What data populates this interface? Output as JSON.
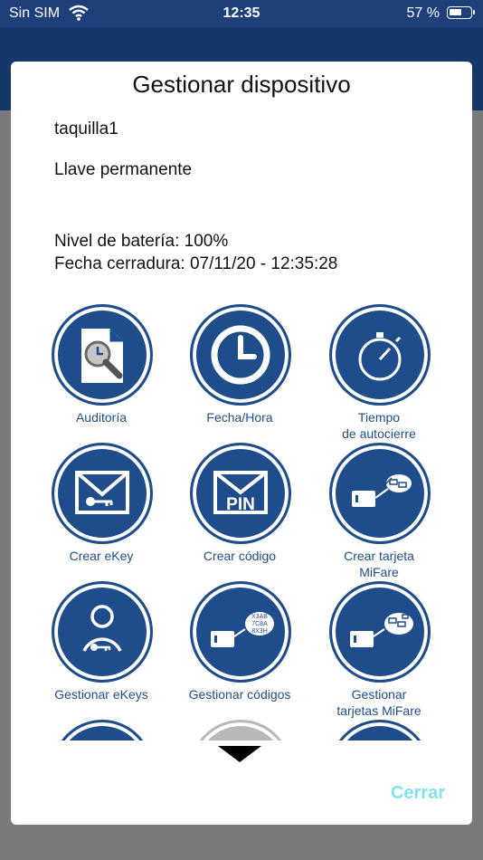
{
  "status_bar": {
    "carrier": "Sin SIM",
    "time": "12:35",
    "battery_percent": "57 %"
  },
  "modal": {
    "title": "Gestionar dispositivo",
    "device_name": "taquilla1",
    "key_type": "Llave permanente",
    "battery_level": "Nivel de batería: 100%",
    "lock_date": "Fecha cerradura: 07/11/20 - 12:35:28",
    "close_label": "Cerrar"
  },
  "actions": [
    {
      "label": "Auditoría",
      "icon": "audit-icon"
    },
    {
      "label": "Fecha/Hora",
      "icon": "clock-icon"
    },
    {
      "label": "Tiempo\nde autocierre",
      "icon": "stopwatch-icon"
    },
    {
      "label": "Crear eKey",
      "icon": "envelope-key-icon"
    },
    {
      "label": "Crear código",
      "icon": "envelope-pin-icon"
    },
    {
      "label": "Crear tarjeta\nMiFare",
      "icon": "card-create-icon"
    },
    {
      "label": "Gestionar eKeys",
      "icon": "user-key-icon"
    },
    {
      "label": "Gestionar códigos",
      "icon": "codes-manage-icon"
    },
    {
      "label": "Gestionar\ntarjetas MiFare",
      "icon": "cards-manage-icon"
    }
  ],
  "colors": {
    "primary": "#1f4d8c",
    "close": "#7fe4ee",
    "status_bar": "#1d3f7a"
  }
}
